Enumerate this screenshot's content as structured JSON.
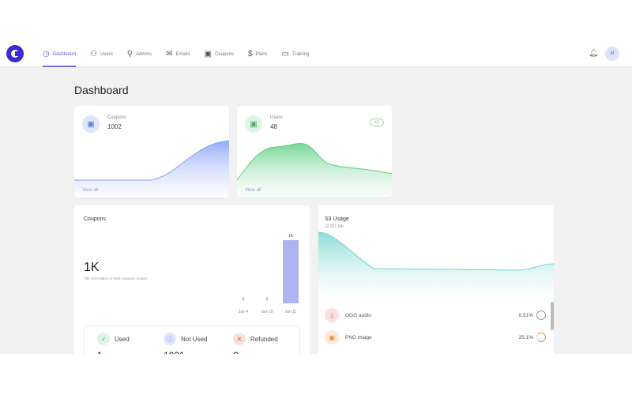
{
  "nav": [
    {
      "label": "Dashboard",
      "icon": "dashboard-icon",
      "glyph": "◷",
      "active": true
    },
    {
      "label": "Users",
      "icon": "users-icon",
      "glyph": "⚇",
      "active": false
    },
    {
      "label": "Admins",
      "icon": "admins-icon",
      "glyph": "⚲",
      "active": false
    },
    {
      "label": "Emails",
      "icon": "mail-icon",
      "glyph": "✉",
      "active": false
    },
    {
      "label": "Coupons",
      "icon": "coupon-icon",
      "glyph": "▣",
      "active": false
    },
    {
      "label": "Plans",
      "icon": "plans-icon",
      "glyph": "$",
      "active": false
    },
    {
      "label": "Training",
      "icon": "video-icon",
      "glyph": "▭",
      "active": false
    }
  ],
  "user": {
    "avatar_initial": "M"
  },
  "page_title": "Dashboard",
  "coupons_card": {
    "label": "Coupons",
    "value": "1002",
    "link": "View all"
  },
  "users_card": {
    "label": "Users",
    "value": "48",
    "badge": "+1",
    "link": "View all"
  },
  "coupons_panel": {
    "title": "Coupons",
    "big_value": "1K",
    "subtitle": "The information of total coupons created",
    "stats": [
      {
        "label": "Used",
        "value": "1",
        "icon": "check-icon",
        "glyph": "✓",
        "color": "#4aa866",
        "bg": "#dff4e4"
      },
      {
        "label": "Not Used",
        "value": "1001",
        "icon": "info-icon",
        "glyph": "ⓘ",
        "color": "#5a7be0",
        "bg": "#dfe6fb"
      },
      {
        "label": "Refunded",
        "value": "0",
        "icon": "close-icon",
        "glyph": "✕",
        "color": "#e05a5a",
        "bg": "#fbe0e0"
      }
    ]
  },
  "s3_panel": {
    "title": "S3 Usage",
    "subtitle": "12.921 Mb",
    "files": [
      {
        "label": "OGG audio",
        "percent": "0.51%",
        "icon": "audio-file-icon",
        "glyph": "♫",
        "color": "#e05a5a",
        "bg": "#fbe0e0"
      },
      {
        "label": "PNG image",
        "percent": "25.1%",
        "icon": "image-file-icon",
        "glyph": "▣",
        "color": "#f08a3c",
        "bg": "#fde8d8"
      }
    ]
  },
  "chart_data": [
    {
      "type": "bar",
      "categories": [
        "Jan 4",
        "Jan 10",
        "Jan 11"
      ],
      "values": [
        1,
        1,
        1000
      ],
      "data_labels": [
        "1",
        "1",
        "1K"
      ],
      "ylim": [
        0,
        1000
      ],
      "color": "#aeb4f0"
    }
  ]
}
